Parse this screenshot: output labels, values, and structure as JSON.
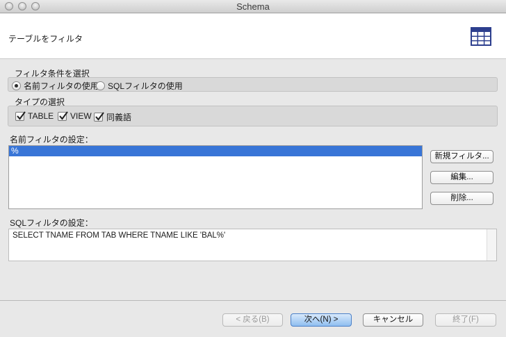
{
  "window": {
    "title": "Schema"
  },
  "header": {
    "title": "テーブルをフィルタ",
    "icon": "table-grid-icon",
    "icon_color": "#2d3f8e"
  },
  "filter_condition": {
    "label": "フィルタ条件を選択",
    "options": [
      {
        "label": "名前フィルタの使用",
        "selected": true
      },
      {
        "label": "SQLフィルタの使用",
        "selected": false
      }
    ]
  },
  "type_selection": {
    "label": "タイプの選択",
    "options": [
      {
        "label": "TABLE",
        "checked": true
      },
      {
        "label": "VIEW",
        "checked": true
      },
      {
        "label": "同義語",
        "checked": true
      }
    ]
  },
  "name_filter": {
    "label": "名前フィルタの設定：",
    "items": [
      {
        "text": "%",
        "selected": true
      }
    ],
    "buttons": {
      "new": "新規フィルタ...",
      "edit": "編集...",
      "delete": "削除..."
    }
  },
  "sql_filter": {
    "label": "SQLフィルタの設定：",
    "value": "SELECT TNAME FROM TAB WHERE TNAME LIKE 'BAL%'"
  },
  "footer": {
    "back": "< 戻る(B)",
    "next": "次へ(N) >",
    "cancel": "キャンセル",
    "finish": "終了(F)"
  },
  "colors": {
    "selection": "#3875d7",
    "primary_button": "#8fbef0"
  }
}
